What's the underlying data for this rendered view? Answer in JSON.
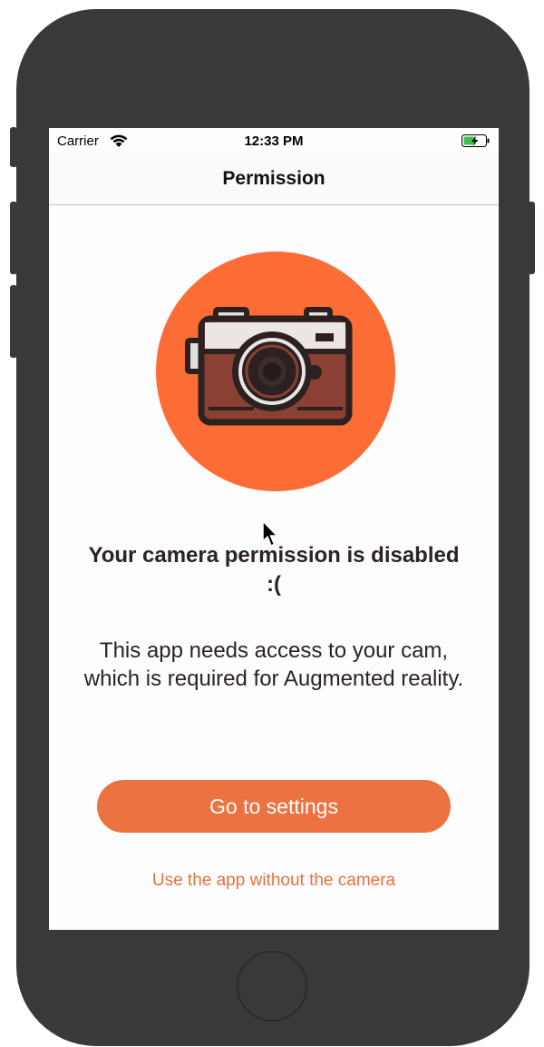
{
  "status_bar": {
    "carrier": "Carrier",
    "time": "12:33 PM"
  },
  "nav": {
    "title": "Permission"
  },
  "hero": {
    "icon": "camera-icon",
    "circle_color": "#fb6d35"
  },
  "content": {
    "headline": "Your camera permission is disabled :(",
    "body": "This app needs access to your cam, which is required for Augmented reality."
  },
  "actions": {
    "settings_label": "Go to settings",
    "skip_label": "Use the app without the camera"
  },
  "colors": {
    "accent": "#ec7241",
    "link": "#e8703d",
    "device": "#3a383b"
  }
}
